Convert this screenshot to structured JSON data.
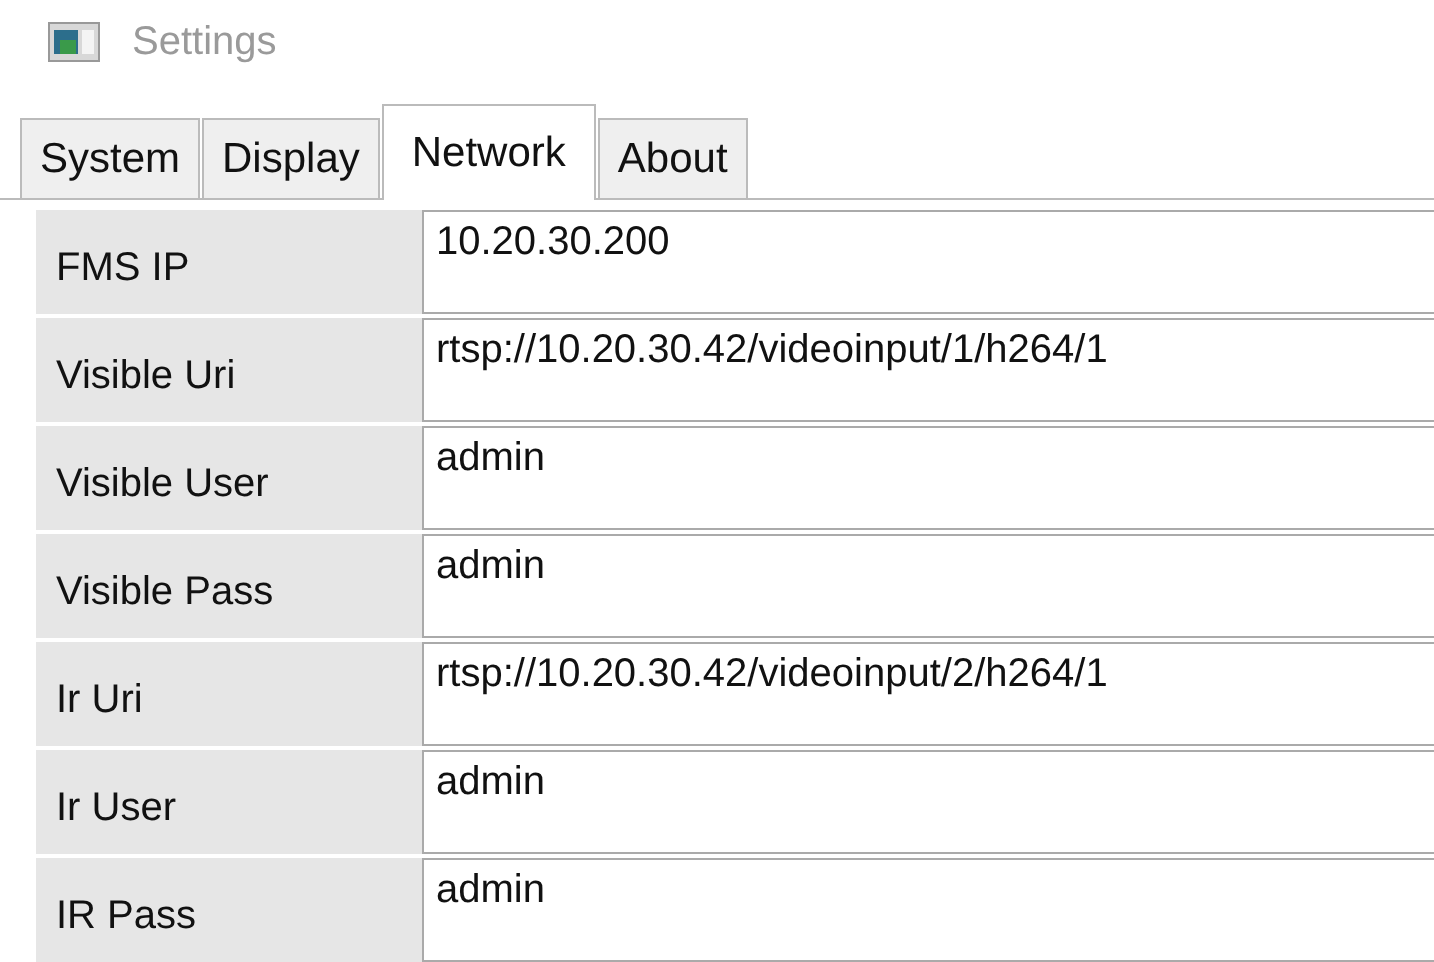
{
  "window": {
    "title": "Settings"
  },
  "tabs": [
    {
      "label": "System",
      "selected": false
    },
    {
      "label": "Display",
      "selected": false
    },
    {
      "label": "Network",
      "selected": true
    },
    {
      "label": "About",
      "selected": false
    }
  ],
  "fields": [
    {
      "label": "FMS IP",
      "value": "10.20.30.200"
    },
    {
      "label": "Visible Uri",
      "value": "rtsp://10.20.30.42/videoinput/1/h264/1"
    },
    {
      "label": "Visible User",
      "value": "admin"
    },
    {
      "label": "Visible Pass",
      "value": "admin"
    },
    {
      "label": "Ir Uri",
      "value": "rtsp://10.20.30.42/videoinput/2/h264/1"
    },
    {
      "label": "Ir User",
      "value": "admin"
    },
    {
      "label": "IR Pass",
      "value": "admin"
    }
  ]
}
